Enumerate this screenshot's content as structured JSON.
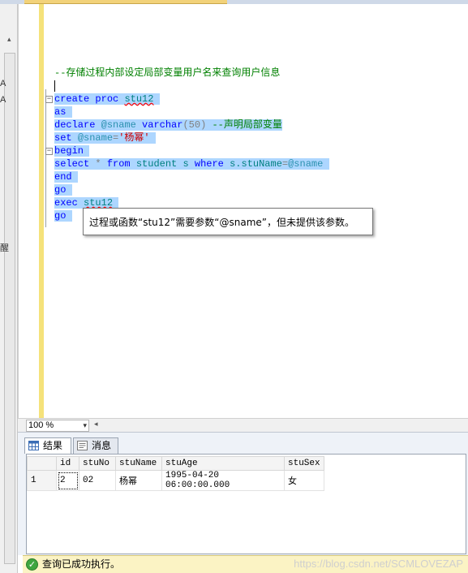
{
  "editor": {
    "comment_line": "--存储过程内部设定局部变量用户名来查询用户信息",
    "code": {
      "create": "create",
      "proc": "proc",
      "proc_name": "stu12",
      "as": "as",
      "declare": "declare",
      "var_sname": "@sname",
      "varchar": "varchar",
      "varchar_len": "(50)",
      "declare_comment": "--声明局部变量",
      "set": "set",
      "set_value": "'杨幂'",
      "begin": "begin",
      "select": "select",
      "star": "*",
      "from": "from",
      "table": "student",
      "alias": "s",
      "where": "where",
      "column": "s.stuName",
      "eq": "=",
      "end": "end",
      "go": "go",
      "exec": "exec",
      "exec_target": "stu12"
    },
    "tooltip": "过程或函数“stu12”需要参数“@sname”，但未提供该参数。"
  },
  "zoom": {
    "value": "100 %"
  },
  "tabs": {
    "results": "结果",
    "messages": "消息"
  },
  "results": {
    "columns": [
      "id",
      "stuNo",
      "stuName",
      "stuAge",
      "stuSex"
    ],
    "rows": [
      {
        "row_number": "1",
        "id": "2",
        "stuNo": "02",
        "stuName": "杨幂",
        "stuAge": "1995-04-20 06:00:00.000",
        "stuSex": "女"
      }
    ]
  },
  "status": {
    "text": "查询已成功执行。",
    "watermark": "https://blog.csdn.net/SCMLOVEZAP"
  },
  "sidebar": {
    "letters": [
      "A",
      "A",
      "醒"
    ]
  },
  "colors": {
    "keyword": "#0000ff",
    "comment": "#008000",
    "string": "#d00000",
    "variable": "#2b91af",
    "selection": "#add6ff",
    "status_bg": "#fbf3c4"
  }
}
